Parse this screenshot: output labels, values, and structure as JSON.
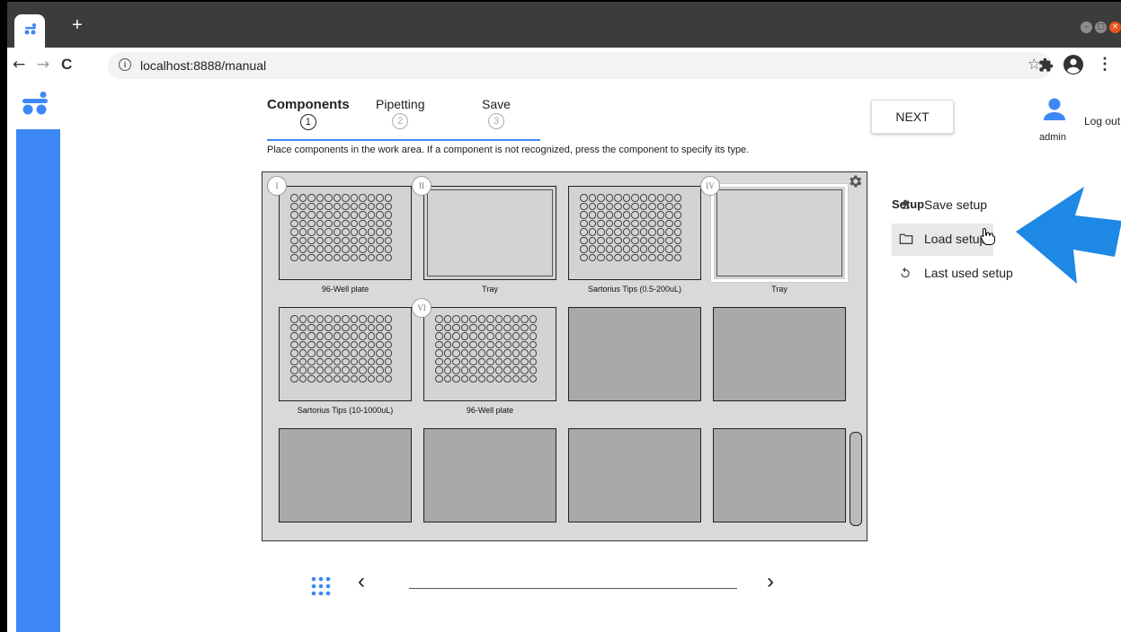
{
  "browser": {
    "new_tab": "+",
    "url": "localhost:8888/manual",
    "window_buttons": [
      "–",
      "□",
      "×"
    ]
  },
  "nav_glyphs": {
    "back": "←",
    "forward": "→",
    "reload": "C",
    "info": "i",
    "star": "☆",
    "menu": "⋮"
  },
  "stepper": {
    "steps": [
      {
        "label": "Components",
        "num": "1"
      },
      {
        "label": "Pipetting",
        "num": "2"
      },
      {
        "label": "Save",
        "num": "3"
      }
    ]
  },
  "instruction": "Place components in the work area. If a component is not recognized, press the component to specify its type.",
  "next_label": "NEXT",
  "user": {
    "logout": "Log out",
    "name": "admin"
  },
  "workarea": {
    "slots": [
      {
        "badge": "I",
        "label": "96-Well plate"
      },
      {
        "badge": "II",
        "label": "Tray"
      },
      {
        "badge": "",
        "label": "Sartorius Tips (0.5-200uL)"
      },
      {
        "badge": "IV",
        "label": "Tray"
      },
      {
        "badge": "",
        "label": "Sartorius Tips (10-1000uL)"
      },
      {
        "badge": "VI",
        "label": "96-Well plate"
      }
    ]
  },
  "setup": {
    "title": "Setup",
    "items": [
      {
        "label": "Save setup",
        "icon": "download-icon"
      },
      {
        "label": "Load setup",
        "icon": "folder-icon"
      },
      {
        "label": "Last used setup",
        "icon": "history-icon"
      }
    ]
  },
  "bottom_nav": {
    "prev": "‹",
    "next": "›"
  },
  "colors": {
    "accent": "#3d88f5",
    "slot_empty": "#a9a9a9",
    "slot_filled": "#d3d3d3",
    "workarea": "#d9d9d9"
  }
}
